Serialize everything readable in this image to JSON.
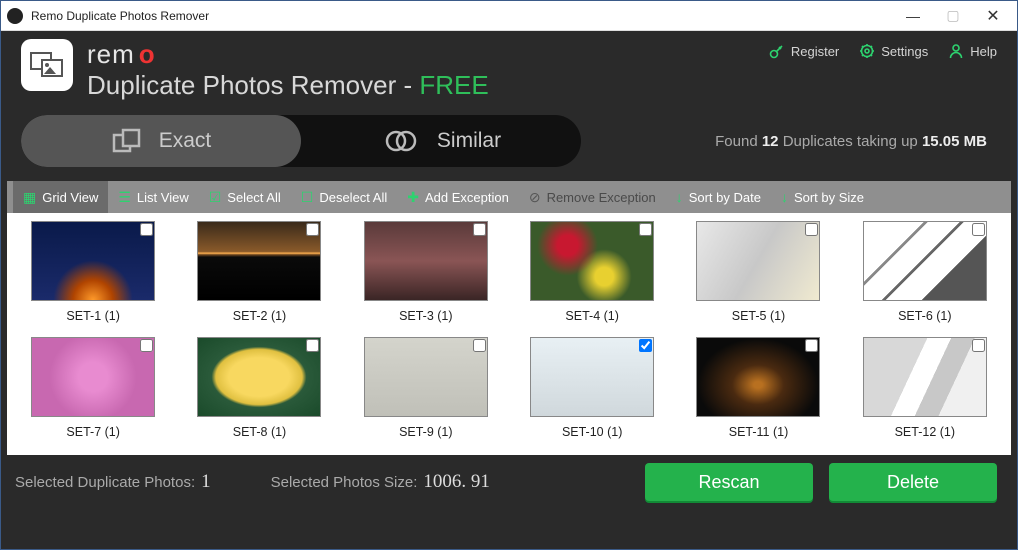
{
  "window": {
    "title": "Remo Duplicate Photos Remover"
  },
  "brand": {
    "name_prefix": "rem",
    "name_o": "o",
    "subtitle_main": "Duplicate Photos Remover - ",
    "subtitle_free": "FREE"
  },
  "top_actions": {
    "register": "Register",
    "settings": "Settings",
    "help": "Help"
  },
  "tabs": {
    "exact": "Exact",
    "similar": "Similar"
  },
  "status": {
    "prefix": "Found ",
    "count": "12",
    "mid": " Duplicates taking up ",
    "size": "15.05 MB"
  },
  "toolbar": {
    "grid_view": "Grid View",
    "list_view": "List View",
    "select_all": "Select All",
    "deselect_all": "Deselect All",
    "add_exception": "Add Exception",
    "remove_exception": "Remove Exception",
    "sort_date": "Sort by Date",
    "sort_size": "Sort by Size"
  },
  "sets": [
    {
      "label": "SET-1 (1)"
    },
    {
      "label": "SET-2 (1)"
    },
    {
      "label": "SET-3 (1)"
    },
    {
      "label": "SET-4 (1)"
    },
    {
      "label": "SET-5 (1)"
    },
    {
      "label": "SET-6 (1)"
    },
    {
      "label": "SET-7 (1)"
    },
    {
      "label": "SET-8 (1)"
    },
    {
      "label": "SET-9 (1)"
    },
    {
      "label": "SET-10 (1)"
    },
    {
      "label": "SET-11 (1)"
    },
    {
      "label": "SET-12 (1)"
    }
  ],
  "selection": {
    "photos_label": "Selected Duplicate Photos:",
    "photos_count": "1",
    "size_label": "Selected Photos Size:",
    "size_value": "1006. 91"
  },
  "buttons": {
    "rescan": "Rescan",
    "delete": "Delete"
  }
}
